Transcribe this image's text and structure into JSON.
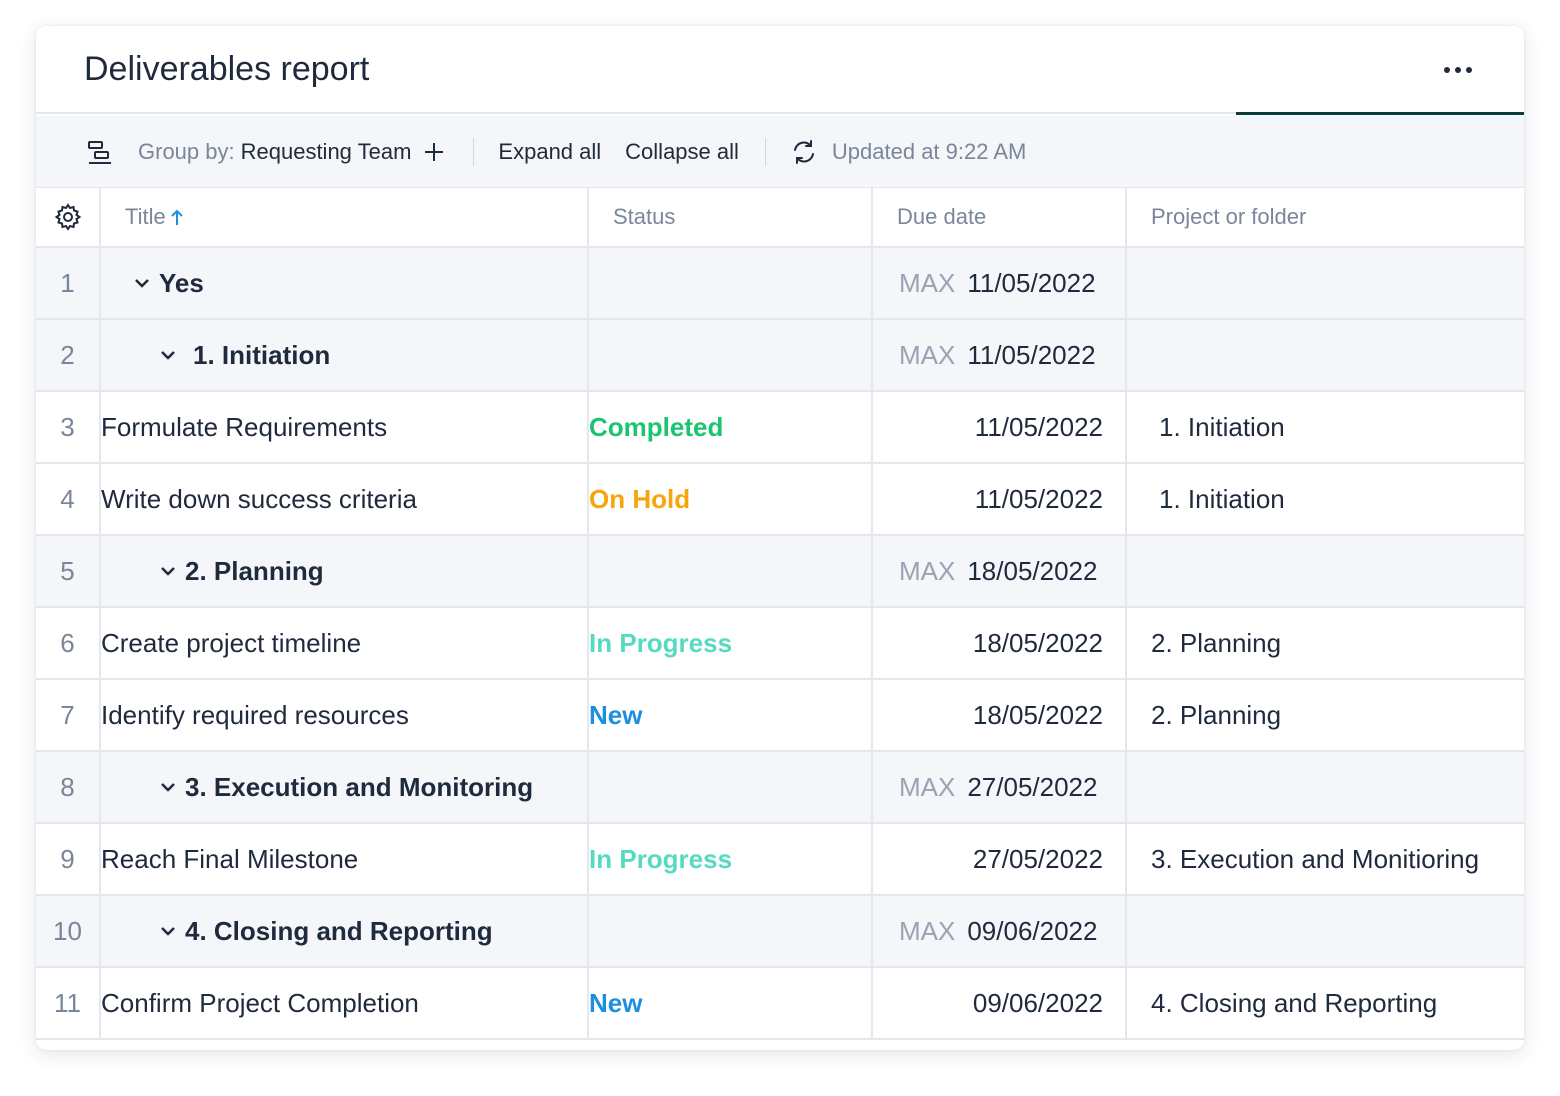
{
  "header": {
    "title": "Deliverables report",
    "more_icon": "more-horizontal-icon"
  },
  "toolbar": {
    "group_by_label": "Group by:",
    "group_by_value": "Requesting Team",
    "expand_all": "Expand all",
    "collapse_all": "Collapse all",
    "updated": "Updated at 9:22 AM"
  },
  "columns": {
    "title": "Title",
    "status": "Status",
    "due_date": "Due date",
    "project": "Project or folder"
  },
  "colors": {
    "completed": "#1bc46e",
    "on_hold": "#f6a609",
    "in_progress": "#56dbc1",
    "new": "#1d8ee0"
  },
  "rows": [
    {
      "num": "1",
      "kind": "group",
      "level": 1,
      "title": "Yes",
      "max": "MAX",
      "due": "11/05/2022"
    },
    {
      "num": "2",
      "kind": "group",
      "level": 2,
      "title": "1. Initiation",
      "max": "MAX",
      "due": "11/05/2022"
    },
    {
      "num": "3",
      "kind": "item",
      "title": "Formulate Requirements",
      "status": "Completed",
      "status_key": "completed",
      "due": "11/05/2022",
      "project": "1. Initiation"
    },
    {
      "num": "4",
      "kind": "item",
      "title": "Write down success criteria",
      "status": "On Hold",
      "status_key": "on_hold",
      "due": "11/05/2022",
      "project": "1. Initiation"
    },
    {
      "num": "5",
      "kind": "group",
      "level": 2,
      "title": "2. Planning",
      "max": "MAX",
      "due": "18/05/2022"
    },
    {
      "num": "6",
      "kind": "item",
      "title": "Create project timeline",
      "status": "In Progress",
      "status_key": "in_progress",
      "due": "18/05/2022",
      "project": "2. Planning"
    },
    {
      "num": "7",
      "kind": "item",
      "title": "Identify required resources",
      "status": "New",
      "status_key": "new",
      "due": "18/05/2022",
      "project": "2. Planning"
    },
    {
      "num": "8",
      "kind": "group",
      "level": 2,
      "title": "3. Execution and Monitoring",
      "max": "MAX",
      "due": "27/05/2022"
    },
    {
      "num": "9",
      "kind": "item",
      "title": "Reach Final Milestone",
      "status": "In Progress",
      "status_key": "in_progress",
      "due": "27/05/2022",
      "project": "3. Execution and Monitioring"
    },
    {
      "num": "10",
      "kind": "group",
      "level": 2,
      "title": "4. Closing and Reporting",
      "max": "MAX",
      "due": "09/06/2022"
    },
    {
      "num": "11",
      "kind": "item",
      "title": "Confirm Project Completion",
      "status": "New",
      "status_key": "new",
      "due": "09/06/2022",
      "project": "4. Closing and Reporting"
    }
  ]
}
